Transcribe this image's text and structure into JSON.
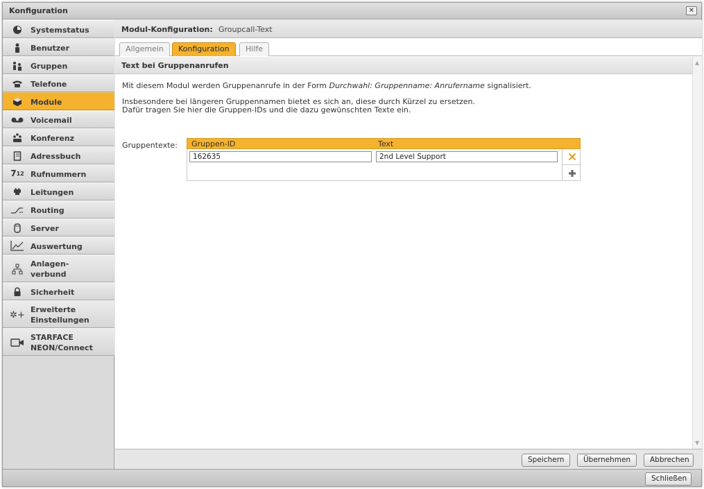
{
  "window": {
    "title": "Konfiguration",
    "close_label": "✕"
  },
  "sidebar": {
    "items": [
      {
        "label": "Systemstatus",
        "icon": "dashboard-icon"
      },
      {
        "label": "Benutzer",
        "icon": "user-icon"
      },
      {
        "label": "Gruppen",
        "icon": "users-icon"
      },
      {
        "label": "Telefone",
        "icon": "phone-icon"
      },
      {
        "label": "Module",
        "icon": "cube-icon",
        "active": true
      },
      {
        "label": "Voicemail",
        "icon": "voicemail-icon"
      },
      {
        "label": "Konferenz",
        "icon": "conference-icon"
      },
      {
        "label": "Adressbuch",
        "icon": "addressbook-icon"
      },
      {
        "label": "Rufnummern",
        "icon": "numbers-icon"
      },
      {
        "label": "Leitungen",
        "icon": "plug-icon"
      },
      {
        "label": "Routing",
        "icon": "routing-icon"
      },
      {
        "label": "Server",
        "icon": "server-icon"
      },
      {
        "label": "Auswertung",
        "icon": "chart-icon"
      },
      {
        "label_line1": "Anlagen-",
        "label_line2": "verbund",
        "icon": "network-icon"
      },
      {
        "label": "Sicherheit",
        "icon": "lock-icon"
      },
      {
        "label_line1": "Erweiterte",
        "label_line2": "Einstellungen",
        "icon": "advanced-settings-icon"
      },
      {
        "label_line1": "STARFACE",
        "label_line2": "NEON/Connect",
        "icon": "camera-icon"
      }
    ]
  },
  "main": {
    "header_label": "Modul-Konfiguration:",
    "header_value": "Groupcall-Text",
    "tabs": [
      {
        "label": "Allgemein"
      },
      {
        "label": "Konfiguration",
        "active": true
      },
      {
        "label": "Hilfe"
      }
    ],
    "section_title": "Text bei Gruppenanrufen",
    "para1_pre": "Mit diesem Modul werden Gruppenanrufe in der Form ",
    "para1_em": "Durchwahl: Gruppenname: Anrufername",
    "para1_post": " signalisiert.",
    "para2_line1": "Insbesondere bei längeren Gruppennamen bietet es sich an, diese durch Kürzel zu ersetzen.",
    "para2_line2": "Dafür tragen Sie hier die Gruppen-IDs und die dazu gewünschten Texte ein.",
    "grid_label": "Gruppentexte:",
    "grid": {
      "columns": [
        "Gruppen-ID",
        "Text"
      ],
      "rows": [
        {
          "id": "162635",
          "text": "2nd Level Support"
        }
      ]
    },
    "buttons": {
      "save": "Speichern",
      "apply": "Übernehmen",
      "cancel": "Abbrechen"
    }
  },
  "footer": {
    "close": "Schließen"
  },
  "colors": {
    "accent": "#f5b22e",
    "delete": "#e89a1c"
  }
}
